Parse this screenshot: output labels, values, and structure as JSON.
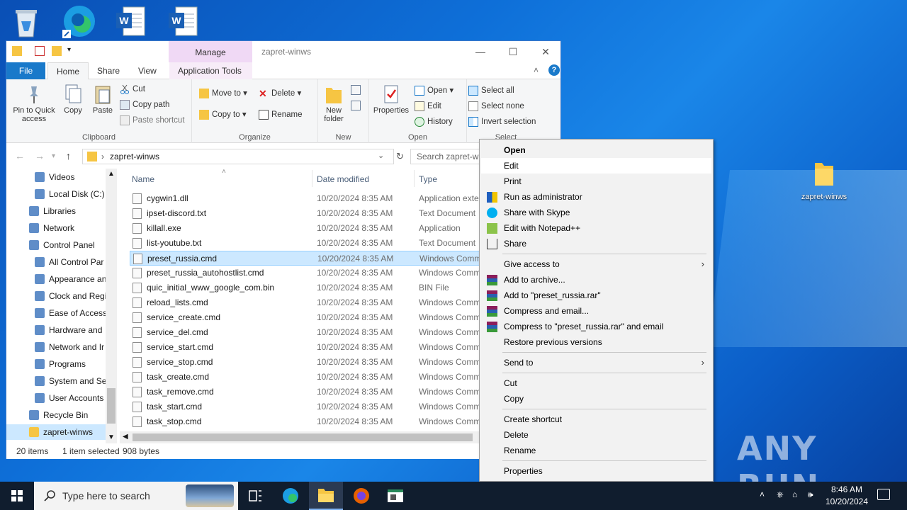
{
  "desktop": {
    "icons": [
      {
        "name": "recycle-bin-icon"
      },
      {
        "name": "edge-shortcut-icon"
      },
      {
        "name": "word-document-icon"
      },
      {
        "name": "word-document-icon"
      }
    ],
    "folder_label": "zapret-winws"
  },
  "window": {
    "title": "zapret-winws",
    "manage_label": "Manage",
    "tabs": [
      "File",
      "Home",
      "Share",
      "View",
      "Application Tools"
    ],
    "ribbon": {
      "clipboard": {
        "label": "Clipboard",
        "pin": "Pin to Quick access",
        "copy": "Copy",
        "paste": "Paste",
        "cut": "Cut",
        "copy_path": "Copy path",
        "paste_shortcut": "Paste shortcut"
      },
      "organize": {
        "label": "Organize",
        "move_to": "Move to",
        "delete": "Delete",
        "copy_to": "Copy to",
        "rename": "Rename"
      },
      "new": {
        "label": "New",
        "new_folder": "New folder"
      },
      "open": {
        "label": "Open",
        "properties": "Properties",
        "open": "Open",
        "edit": "Edit",
        "history": "History"
      },
      "select": {
        "label": "Select",
        "select_all": "Select all",
        "select_none": "Select none",
        "invert": "Invert selection"
      }
    },
    "address": {
      "path": "zapret-winws",
      "search_placeholder": "Search zapret-wi"
    },
    "nav": [
      {
        "label": "Videos",
        "indent": 1
      },
      {
        "label": "Local Disk (C:)",
        "indent": 1
      },
      {
        "label": "Libraries",
        "indent": 0
      },
      {
        "label": "Network",
        "indent": 0
      },
      {
        "label": "Control Panel",
        "indent": 0
      },
      {
        "label": "All Control Par",
        "indent": 1
      },
      {
        "label": "Appearance an",
        "indent": 1
      },
      {
        "label": "Clock and Regi",
        "indent": 1
      },
      {
        "label": "Ease of Access",
        "indent": 1
      },
      {
        "label": "Hardware and",
        "indent": 1
      },
      {
        "label": "Network and Ir",
        "indent": 1
      },
      {
        "label": "Programs",
        "indent": 1
      },
      {
        "label": "System and Se",
        "indent": 1
      },
      {
        "label": "User Accounts",
        "indent": 1
      },
      {
        "label": "Recycle Bin",
        "indent": 0
      },
      {
        "label": "zapret-winws",
        "indent": 0,
        "selected": true
      }
    ],
    "columns": {
      "name": "Name",
      "date": "Date modified",
      "type": "Type"
    },
    "files": [
      {
        "name": "cygwin1.dll",
        "date": "10/20/2024 8:35 AM",
        "type": "Application exte"
      },
      {
        "name": "ipset-discord.txt",
        "date": "10/20/2024 8:35 AM",
        "type": "Text Document"
      },
      {
        "name": "killall.exe",
        "date": "10/20/2024 8:35 AM",
        "type": "Application"
      },
      {
        "name": "list-youtube.txt",
        "date": "10/20/2024 8:35 AM",
        "type": "Text Document"
      },
      {
        "name": "preset_russia.cmd",
        "date": "10/20/2024 8:35 AM",
        "type": "Windows Comm",
        "selected": true
      },
      {
        "name": "preset_russia_autohostlist.cmd",
        "date": "10/20/2024 8:35 AM",
        "type": "Windows Comm"
      },
      {
        "name": "quic_initial_www_google_com.bin",
        "date": "10/20/2024 8:35 AM",
        "type": "BIN File"
      },
      {
        "name": "reload_lists.cmd",
        "date": "10/20/2024 8:35 AM",
        "type": "Windows Comm"
      },
      {
        "name": "service_create.cmd",
        "date": "10/20/2024 8:35 AM",
        "type": "Windows Comm"
      },
      {
        "name": "service_del.cmd",
        "date": "10/20/2024 8:35 AM",
        "type": "Windows Comm"
      },
      {
        "name": "service_start.cmd",
        "date": "10/20/2024 8:35 AM",
        "type": "Windows Comm"
      },
      {
        "name": "service_stop.cmd",
        "date": "10/20/2024 8:35 AM",
        "type": "Windows Comm"
      },
      {
        "name": "task_create.cmd",
        "date": "10/20/2024 8:35 AM",
        "type": "Windows Comm"
      },
      {
        "name": "task_remove.cmd",
        "date": "10/20/2024 8:35 AM",
        "type": "Windows Comm"
      },
      {
        "name": "task_start.cmd",
        "date": "10/20/2024 8:35 AM",
        "type": "Windows Comm"
      },
      {
        "name": "task_stop.cmd",
        "date": "10/20/2024 8:35 AM",
        "type": "Windows Comm"
      }
    ],
    "status": {
      "count": "20 items",
      "selected": "1 item selected",
      "size": "908 bytes"
    }
  },
  "context_menu": {
    "items": [
      {
        "label": "Open",
        "bold": true
      },
      {
        "label": "Edit",
        "hover": true
      },
      {
        "label": "Print"
      },
      {
        "label": "Run as administrator",
        "icon": "shield-icon"
      },
      {
        "label": "Share with Skype",
        "icon": "skype-icon"
      },
      {
        "label": "Edit with Notepad++",
        "icon": "notepadpp-icon"
      },
      {
        "label": "Share",
        "icon": "share-icon"
      },
      {
        "sep": true
      },
      {
        "label": "Give access to",
        "submenu": true
      },
      {
        "label": "Add to archive...",
        "icon": "winrar-icon"
      },
      {
        "label": "Add to \"preset_russia.rar\"",
        "icon": "winrar-icon"
      },
      {
        "label": "Compress and email...",
        "icon": "winrar-icon"
      },
      {
        "label": "Compress to \"preset_russia.rar\" and email",
        "icon": "winrar-icon"
      },
      {
        "label": "Restore previous versions"
      },
      {
        "sep": true
      },
      {
        "label": "Send to",
        "submenu": true
      },
      {
        "sep": true
      },
      {
        "label": "Cut"
      },
      {
        "label": "Copy"
      },
      {
        "sep": true
      },
      {
        "label": "Create shortcut"
      },
      {
        "label": "Delete"
      },
      {
        "label": "Rename"
      },
      {
        "sep": true
      },
      {
        "label": "Properties"
      }
    ]
  },
  "taskbar": {
    "search_placeholder": "Type here to search",
    "time": "8:46 AM",
    "date": "10/20/2024"
  },
  "watermark": "ANY RUN"
}
